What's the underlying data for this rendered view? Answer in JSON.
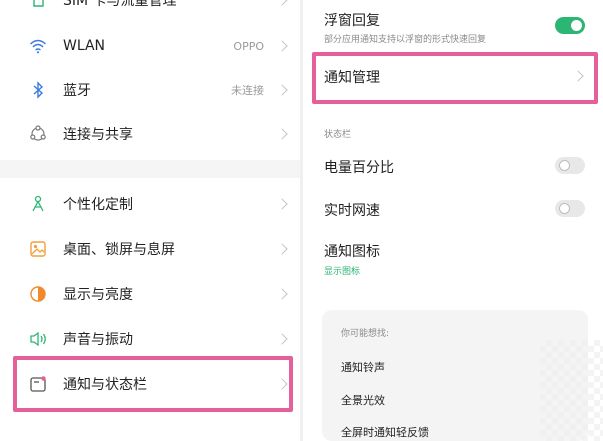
{
  "left_panel": {
    "items": [
      {
        "label": "SIM 卡与流量管理",
        "value": "",
        "icon": "sim-icon"
      },
      {
        "label": "WLAN",
        "value": "OPPO",
        "icon": "wifi-icon"
      },
      {
        "label": "蓝牙",
        "value": "未连接",
        "icon": "bluetooth-icon"
      },
      {
        "label": "连接与共享",
        "value": "",
        "icon": "share-icon"
      },
      {
        "label": "个性化定制",
        "value": "",
        "icon": "personalize-icon"
      },
      {
        "label": "桌面、锁屏与息屏",
        "value": "",
        "icon": "desktop-icon"
      },
      {
        "label": "显示与亮度",
        "value": "",
        "icon": "brightness-icon"
      },
      {
        "label": "声音与振动",
        "value": "",
        "icon": "sound-icon"
      },
      {
        "label": "通知与状态栏",
        "value": "",
        "icon": "notification-icon"
      }
    ]
  },
  "right_panel": {
    "floating_reply": {
      "title": "浮窗回复",
      "subtitle": "部分应用通知支持以浮窗的形式快速回复",
      "enabled": true
    },
    "notification_manage": {
      "title": "通知管理"
    },
    "status_bar_section": "状态栏",
    "battery_percent": {
      "title": "电量百分比",
      "enabled": false
    },
    "realtime_speed": {
      "title": "实时网速",
      "enabled": false
    },
    "notification_icon": {
      "title": "通知图标",
      "subtitle": "显示图标"
    },
    "suggestions": {
      "title": "你可能想找:",
      "items": [
        "通知铃声",
        "全景光效",
        "全屏时通知轻反馈"
      ]
    }
  },
  "colors": {
    "accent": "#2bb673",
    "highlight": "#e5609a"
  }
}
